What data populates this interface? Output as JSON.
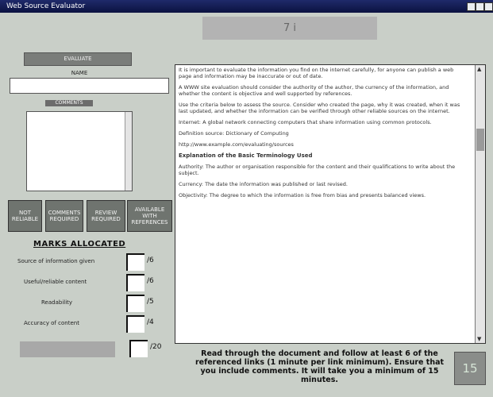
{
  "window": {
    "title": "Web Source Evaluator"
  },
  "top_display": {
    "text": "7 i"
  },
  "left_panel": {
    "evaluate_button": "EVALUATE",
    "name_label": "NAME",
    "comments_label": "COMMENTS",
    "status_buttons": [
      {
        "label": "NOT RELIABLE"
      },
      {
        "label": "COMMENTS REQUIRED"
      },
      {
        "label": "REVIEW REQUIRED"
      },
      {
        "label": "AVAILABLE WITH REFERENCES"
      }
    ]
  },
  "rubric": {
    "title": "MARKS ALLOCATED",
    "criteria": [
      {
        "label": "Source of information given",
        "max": "/6"
      },
      {
        "label": "Useful/reliable content",
        "max": "/6"
      },
      {
        "label": "Readability",
        "max": "/5"
      },
      {
        "label": "Accuracy of content",
        "max": "/4"
      }
    ],
    "total_max": "/20"
  },
  "document": {
    "paragraphs": [
      {
        "type": "text",
        "text": "It is important to evaluate the information you find on the internet carefully, for anyone can publish a web page and information may be inaccurate or out of date."
      },
      {
        "type": "text",
        "text": "A WWW site evaluation should consider the authority of the author, the currency of the information, and whether the content is objective and well supported by references."
      },
      {
        "type": "text",
        "text": "Use the criteria below to assess the source. Consider who created the page, why it was created, when it was last updated, and whether the information can be verified through other reliable sources on the internet."
      },
      {
        "type": "text",
        "text": "Internet: A global network connecting computers that share information using common protocols."
      },
      {
        "type": "text",
        "text": "Definition source: Dictionary of Computing"
      },
      {
        "type": "text",
        "text": "http://www.example.com/evaluating/sources"
      },
      {
        "type": "head",
        "text": "Explanation of the Basic Terminology Used"
      },
      {
        "type": "text",
        "text": "Authority: The author or organisation responsible for the content and their qualifications to write about the subject."
      },
      {
        "type": "text",
        "text": "Currency: The date the information was published or last revised."
      },
      {
        "type": "text",
        "text": "Objectivity: The degree to which the information is free from bias and presents balanced views."
      }
    ]
  },
  "instructions": {
    "text": "Read through the document and follow at least 6 of the referenced links (1 minute per link minimum). Ensure that you include comments. It will take you a minimum of 15 minutes."
  },
  "timer": {
    "value": "15"
  }
}
